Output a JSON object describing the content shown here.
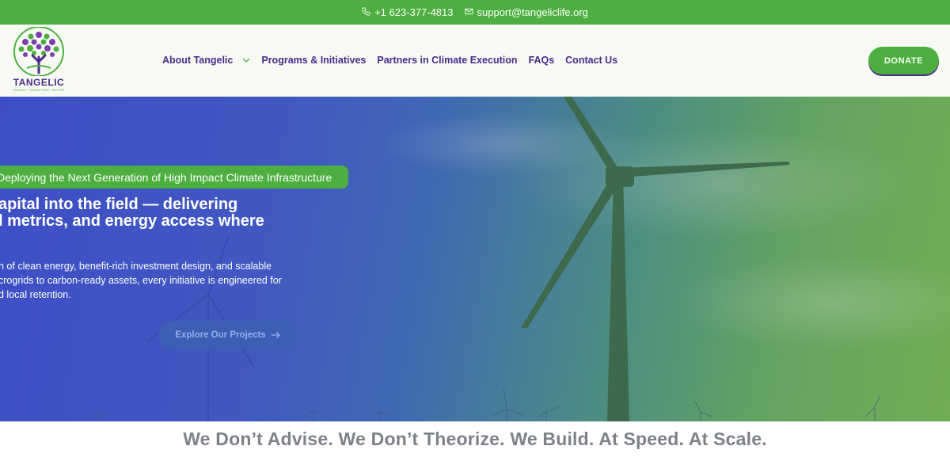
{
  "topbar": {
    "phone": "+1 623-377-4813",
    "email": "support@tangeliclife.org",
    "phone_icon": "phone-icon",
    "email_icon": "mail-icon"
  },
  "header": {
    "brand": "TANGELIC",
    "brand_tagline": "ENGAGE • TRANSFORM • MATTER",
    "nav": [
      {
        "label": "About Tangelic"
      },
      {
        "label": "Programs & Initiatives"
      },
      {
        "label": "Partners in Climate Execution"
      },
      {
        "label": "FAQs"
      },
      {
        "label": "Contact Us"
      }
    ],
    "donate_label": "DONATE"
  },
  "hero": {
    "eyebrow": "Deploying the Next Generation of High Impact Climate Infrastructure",
    "headline": "apital into the field — delivering\nl metrics, and energy access where",
    "body": "n of clean energy, benefit-rich investment design, and scalable\ncrogrids to carbon-ready assets, every initiative is engineered for\nd local retention.",
    "cta_label": "Explore Our Projects"
  },
  "tagline": "We Don’t Advise. We Don’t Theorize. We Build. At Speed. At Scale.",
  "colors": {
    "brand_green": "#4caf3f",
    "brand_purple": "#4b2a8c",
    "hero_blue": "#3e4fc6"
  }
}
